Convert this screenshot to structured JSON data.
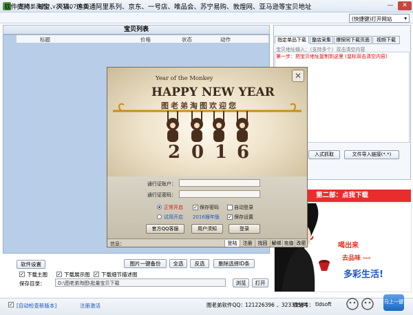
{
  "window": {
    "title": "《图老弟淘图》v20160701版",
    "minimize": "—",
    "close": "✕"
  },
  "support": {
    "text": "软件支持：淘宝、天猫、速卖通阿里系列、京东、一号店、唯品会、苏宁易购、敦煌网、亚马逊等宝贝地址",
    "quick_select": "(快捷键)打开网站"
  },
  "list": {
    "title": "宝贝列表",
    "columns": [
      "标题",
      "价格",
      "状态",
      "动作"
    ]
  },
  "right": {
    "tabs": [
      "指定单品下载",
      "整店采集",
      "爆探同下载页面",
      "视频下载"
    ],
    "url_label": "宝贝地址输入：（支持多个）双击清空内容",
    "url_hint": "第一步：把宝贝地址复制到这里 (鼠标双击清空内容)",
    "btn_fetch": "入式抓取",
    "btn_import": "文件导入链接(*.*)",
    "step2": "第二部：点我下载",
    "ad_text1": "喝出来",
    "ad_text2": "去品味 ---",
    "ad_text3": "多彩生活!"
  },
  "bottom": {
    "settings": "软件设置",
    "batch_backup": "图片一键备份",
    "select_all": "全选",
    "invert": "反选",
    "delete_selected": "删除选择ID条",
    "chk_main": "下载主图",
    "chk_display": "下载展示图",
    "chk_detail": "下载细节描述图",
    "save_label": "保存目录：",
    "save_path": "D:\\图老弟淘图\\批量宝贝下载",
    "browse": "浏览",
    "open": "打开"
  },
  "status": {
    "auto_check": "[自动检查新版本]",
    "register": "注册激活",
    "qq_label": "图老弟软件QQ：",
    "qq_values": "121226396 、32333584",
    "wechat_label": "微信号：",
    "wechat_value": "tldsoft",
    "rocket": "马上一键"
  },
  "dialog": {
    "close": "✕",
    "year_of": "Year of the Monkey",
    "headline": "HAPPY NEW YEAR",
    "welcome": "图老弟淘图欢迎您",
    "year_digits": [
      "2",
      "0",
      "1",
      "6"
    ],
    "account_label": "通行证账户：",
    "password_label": "通行证密码：",
    "radio_normal": "正常开启",
    "radio_trial": "试用开启",
    "save_pwd": "保存密码",
    "auto_login": "自动登录",
    "edition": "2016猴年版",
    "save_settings": "保存设置",
    "btn_qq": "官方QQ客服",
    "btn_notice": "用户须知",
    "btn_login": "登录",
    "info_label": "信息：",
    "tabs": [
      "登陆",
      "注册",
      "找回",
      "解绑",
      "充值",
      "改密"
    ]
  },
  "colors": {
    "accent_red": "#e92d2d",
    "list_bg": "#b8cde8"
  }
}
